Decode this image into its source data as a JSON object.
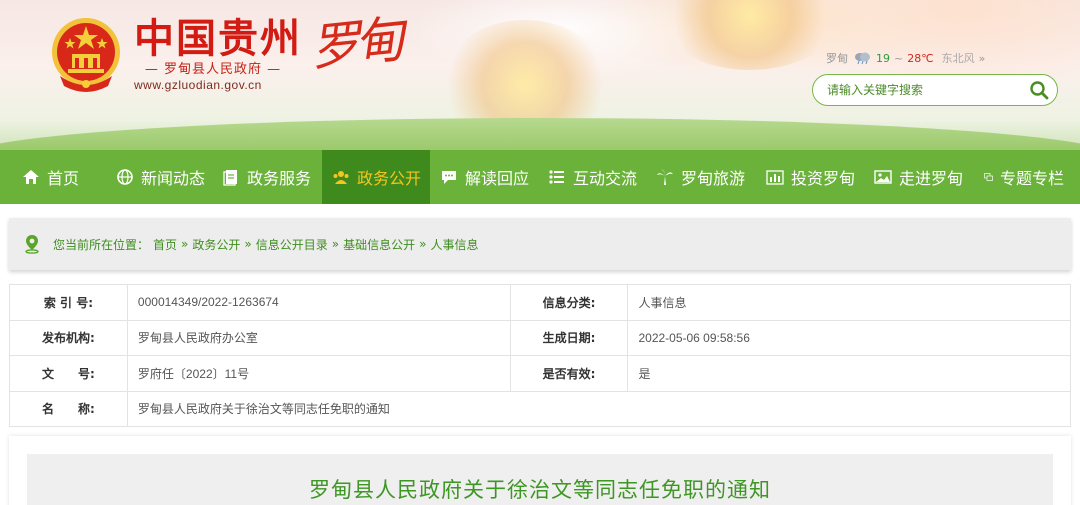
{
  "header": {
    "title": "中国贵州",
    "subtitle": "— 罗甸县人民政府 —",
    "url": "www.gzluodian.gov.cn",
    "calligraphy": "罗甸",
    "weather": {
      "city": "罗甸",
      "icon": "cloud-rain-icon",
      "low": "19",
      "separator": "~",
      "high": "28℃",
      "wind": "东北风",
      "more": "»"
    },
    "search": {
      "placeholder": "请输入关键字搜索"
    }
  },
  "nav": {
    "items": [
      {
        "label": "首页",
        "icon": "home-icon"
      },
      {
        "label": "新闻动态",
        "icon": "globe-icon"
      },
      {
        "label": "政务服务",
        "icon": "document-icon"
      },
      {
        "label": "政务公开",
        "icon": "people-icon"
      },
      {
        "label": "解读回应",
        "icon": "chat-icon"
      },
      {
        "label": "互动交流",
        "icon": "list-icon"
      },
      {
        "label": "罗甸旅游",
        "icon": "palm-icon"
      },
      {
        "label": "投资罗甸",
        "icon": "bar-chart-icon"
      },
      {
        "label": "走进罗甸",
        "icon": "image-icon"
      },
      {
        "label": "专题专栏",
        "icon": "window-icon"
      }
    ],
    "active_index": 3
  },
  "breadcrumb": {
    "prefix": "您当前所在位置：",
    "items": [
      "首页",
      "政务公开",
      "信息公开目录",
      "基础信息公开",
      "人事信息"
    ],
    "sep": "»"
  },
  "meta": {
    "index_label": "索 引 号:",
    "index_value": "000014349/2022-1263674",
    "category_label": "信息分类:",
    "category_value": "人事信息",
    "org_label": "发布机构:",
    "org_value": "罗甸县人民政府办公室",
    "date_label": "生成日期:",
    "date_value": "2022-05-06 09:58:56",
    "doc_label": "文　　号:",
    "doc_value": "罗府任〔2022〕11号",
    "valid_label": "是否有效:",
    "valid_value": "是",
    "name_label": "名　　称:",
    "name_value": "罗甸县人民政府关于徐治文等同志任免职的通知"
  },
  "article": {
    "title": "罗甸县人民政府关于徐治文等同志任免职的通知"
  },
  "colors": {
    "nav_bg": "#6ab23a",
    "nav_active_bg": "#3e8a1c",
    "nav_active_text": "#f5c51e",
    "title_red": "#d21b12",
    "green_text": "#3f8d1e"
  }
}
